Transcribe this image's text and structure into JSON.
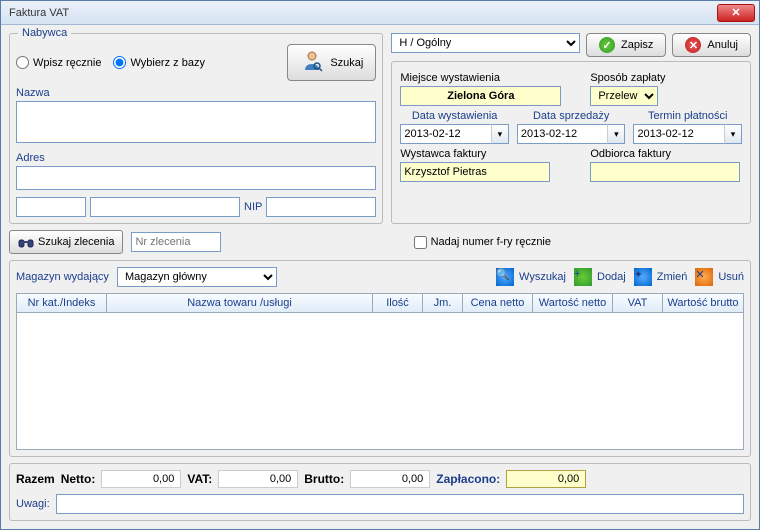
{
  "window": {
    "title": "Faktura VAT"
  },
  "buyer": {
    "legend": "Nabywca",
    "radio_manual": "Wpisz ręcznie",
    "radio_db": "Wybierz z bazy",
    "search": "Szukaj",
    "name_label": "Nazwa",
    "name_value": "",
    "addr_label": "Adres",
    "addr1": "",
    "addr2": "",
    "nip_label": "NIP",
    "nip": ""
  },
  "actions": {
    "save": "Zapisz",
    "cancel": "Anuluj"
  },
  "doc": {
    "type_selected": "H / Ogólny",
    "place_label": "Miejsce wystawienia",
    "place_value": "Zielona Góra",
    "pay_label": "Sposób zapłaty",
    "pay_value": "Przelew",
    "date_issue_label": "Data wystawienia",
    "date_issue": "2013-02-12",
    "date_sale_label": "Data sprzedaży",
    "date_sale": "2013-02-12",
    "date_due_label": "Termin płatności",
    "date_due": "2013-02-12",
    "issuer_label": "Wystawca faktury",
    "issuer": "Krzysztof Pietras",
    "recipient_label": "Odbiorca faktury",
    "recipient": ""
  },
  "order": {
    "search": "Szukaj zlecenia",
    "placeholder": "Nr zlecenia",
    "manual_checkbox": "Nadaj numer f-ry ręcznie"
  },
  "items": {
    "warehouse_label": "Magazyn wydający",
    "warehouse_value": "Magazyn główny",
    "btn_search": "Wyszukaj",
    "btn_add": "Dodaj",
    "btn_edit": "Zmień",
    "btn_delete": "Usuń",
    "cols": {
      "idx": "Nr kat./Indeks",
      "name": "Nazwa towaru /usługi",
      "qty": "Ilość",
      "jm": "Jm.",
      "cn": "Cena netto",
      "wn": "Wartość netto",
      "vat": "VAT",
      "wb": "Wartość brutto"
    }
  },
  "totals": {
    "razem": "Razem",
    "netto_label": "Netto:",
    "netto": "0,00",
    "vat_label": "VAT:",
    "vat": "0,00",
    "brutto_label": "Brutto:",
    "brutto": "0,00",
    "paid_label": "Zapłacono:",
    "paid": "0,00",
    "uwagi_label": "Uwagi:",
    "uwagi": ""
  }
}
